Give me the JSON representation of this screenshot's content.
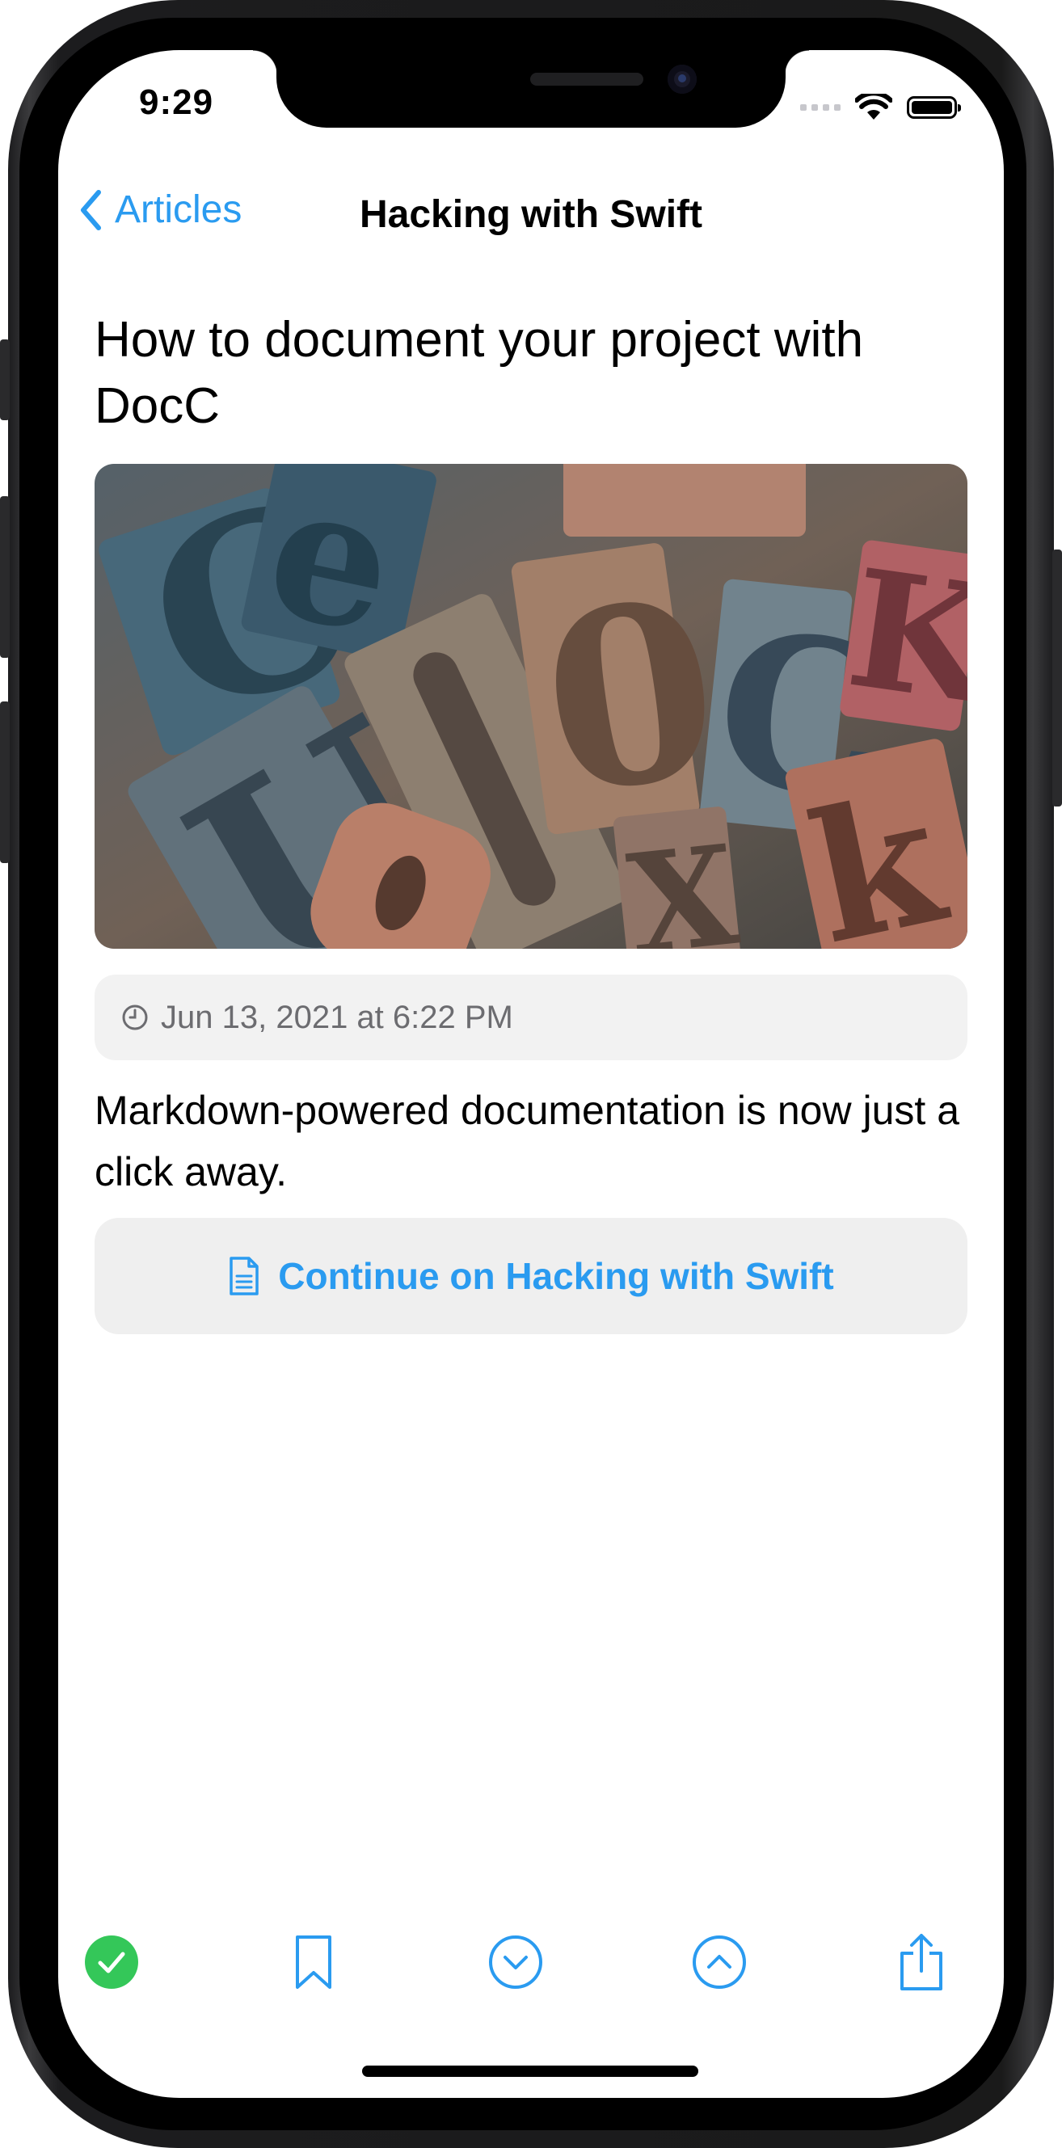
{
  "status_bar": {
    "time": "9:29"
  },
  "nav": {
    "back_label": "Articles",
    "title": "Hacking with Swift"
  },
  "article": {
    "title": "How to document your project with DocC",
    "date": "Jun 13, 2021 at 6:22 PM",
    "summary": "Markdown-powered documentation is now just a click away.",
    "continue_label": "Continue on Hacking with Swift"
  },
  "toolbar": {
    "items": [
      {
        "icon": "checkmark-circle-filled-icon",
        "color": "#34c759"
      },
      {
        "icon": "bookmark-icon",
        "color": "#2a9bf0"
      },
      {
        "icon": "chevron-down-circle-icon",
        "color": "#2a9bf0"
      },
      {
        "icon": "chevron-up-circle-icon",
        "color": "#2a9bf0"
      },
      {
        "icon": "share-icon",
        "color": "#2a9bf0"
      }
    ]
  },
  "colors": {
    "accent": "#2a9bf0",
    "success": "#34c759"
  }
}
